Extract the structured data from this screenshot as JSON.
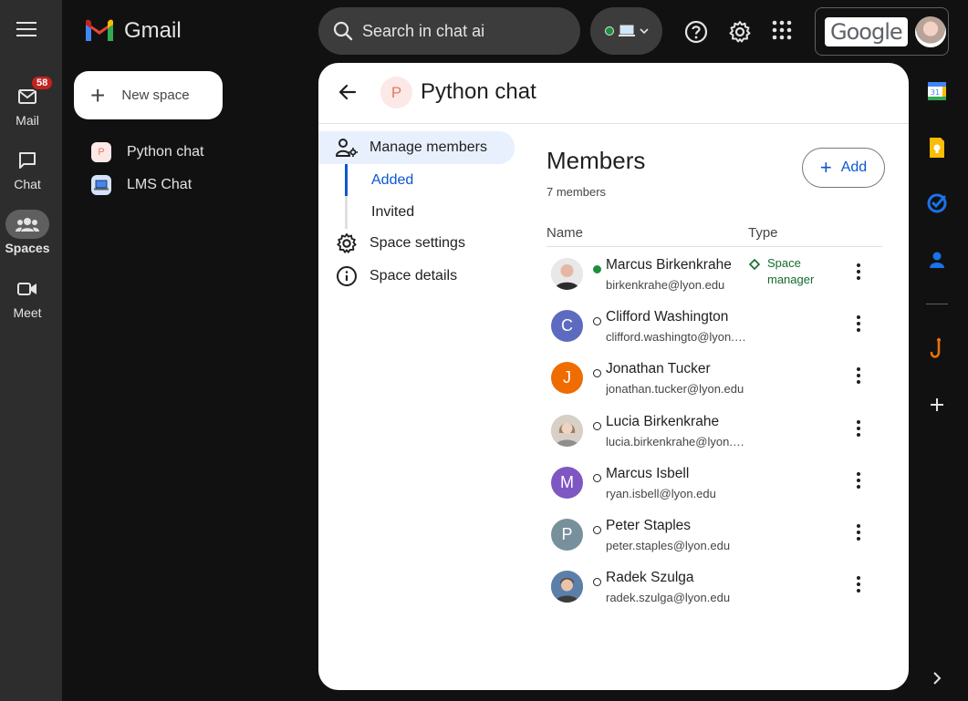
{
  "app": {
    "name": "Gmail"
  },
  "rail": {
    "items": [
      {
        "label": "Mail",
        "icon": "mail-icon",
        "badge": "58"
      },
      {
        "label": "Chat",
        "icon": "chat-icon"
      },
      {
        "label": "Spaces",
        "icon": "spaces-icon",
        "active": true
      },
      {
        "label": "Meet",
        "icon": "meet-icon"
      }
    ]
  },
  "topbar": {
    "search_placeholder": "Search in chat ai",
    "account_brand": "Google"
  },
  "left_panel": {
    "new_space_label": "New space",
    "spaces": [
      {
        "name": "Python chat",
        "initial": "P"
      },
      {
        "name": "LMS Chat",
        "initial": "💻"
      }
    ]
  },
  "card": {
    "title": "Python chat",
    "avatar_initial": "P",
    "nav": {
      "manage_members": "Manage members",
      "added": "Added",
      "invited": "Invited",
      "space_settings": "Space settings",
      "space_details": "Space details"
    },
    "members_title": "Members",
    "members_count": "7 members",
    "add_label": "Add",
    "col_name": "Name",
    "col_type": "Type",
    "members": [
      {
        "name": "Marcus Birkenkrahe",
        "email": "birkenkrahe@lyon.edu",
        "type_line1": "Space",
        "type_line2": "manager",
        "online": true,
        "avatar": "photo",
        "avatar_color": "#8d8d8d"
      },
      {
        "name": "Clifford Washington",
        "email": "clifford.washingto@lyon.edu",
        "initial": "C",
        "avatar_color": "#5c6bc0"
      },
      {
        "name": "Jonathan Tucker",
        "email": "jonathan.tucker@lyon.edu",
        "initial": "J",
        "avatar_color": "#ef6c00"
      },
      {
        "name": "Lucia Birkenkrahe",
        "email": "lucia.birkenkrahe@lyon.edu",
        "avatar": "photo",
        "avatar_color": "#c9b8a8"
      },
      {
        "name": "Marcus Isbell",
        "email": "ryan.isbell@lyon.edu",
        "initial": "M",
        "avatar_color": "#7e57c2"
      },
      {
        "name": "Peter Staples",
        "email": "peter.staples@lyon.edu",
        "initial": "P",
        "avatar_color": "#78909c"
      },
      {
        "name": "Radek Szulga",
        "email": "radek.szulga@lyon.edu",
        "avatar": "photo",
        "avatar_color": "#6d7f99"
      }
    ]
  },
  "colors": {
    "accent": "#0b57d0",
    "online": "#1e8e3e",
    "manager": "#146c2e",
    "badge": "#c5221f"
  }
}
